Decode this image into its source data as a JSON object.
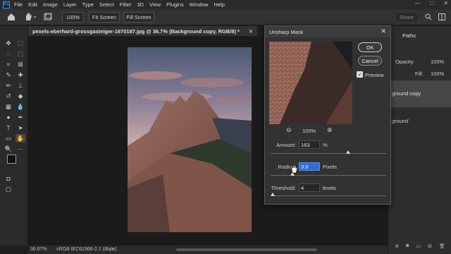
{
  "menubar": {
    "logo": "Ps",
    "items": [
      "File",
      "Edit",
      "Image",
      "Layer",
      "Type",
      "Select",
      "Filter",
      "3D",
      "View",
      "Plugins",
      "Window",
      "Help"
    ],
    "window_controls": [
      "—",
      "□",
      "✕"
    ]
  },
  "optionsbar": {
    "zoom_value": "100%",
    "fit_screen": "Fit Screen",
    "fill_screen": "Fill Screen",
    "share": "Share"
  },
  "document": {
    "tab_title": "pexels-eberhard-grossgasteiger-1670187.jpg @ 36.7% (Background copy, RGB/8) *",
    "tab_close": "✕"
  },
  "statusbar": {
    "zoom": "36.67%",
    "profile": "sRGB IEC61966-2.1 (8bpc)",
    "arrow": ">"
  },
  "rightpanel": {
    "tab_paths": "Paths",
    "opacity_label": "Opacity:",
    "opacity_value": "100%",
    "fill_label": "Fill:",
    "fill_value": "100%",
    "layer_bg_copy": "ground copy",
    "layer_bg": "ground"
  },
  "dialog": {
    "title": "Unsharp Mask",
    "close": "✕",
    "ok": "OK",
    "cancel": "Cancel",
    "preview_label": "Preview",
    "preview_checked": true,
    "zoom": "100%",
    "zoom_out": "⊖",
    "zoom_in": "⊕",
    "amount_label": "Amount:",
    "amount_value": "163",
    "amount_unit": "%",
    "amount_level": 0.67,
    "radius_label": "Radius:",
    "radius_value": "3.8",
    "radius_unit": "Pixels",
    "radius_level": 0.19,
    "threshold_label": "Threshold:",
    "threshold_value": "4",
    "threshold_unit": "levels",
    "threshold_level": 0.02
  },
  "colors": {
    "accent": "#31a8ff",
    "highlight": "#2d6fd6"
  }
}
